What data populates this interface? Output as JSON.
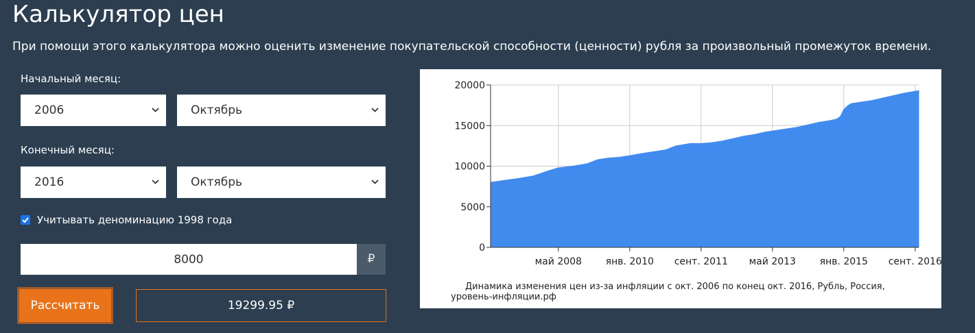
{
  "page": {
    "title": "Калькулятор цен",
    "description": "При помощи этого калькулятора можно оценить изменение покупательской способности (ценности) рубля за произвольный промежуток времени."
  },
  "form": {
    "start_label": "Начальный месяц:",
    "start_year": "2006",
    "start_month": "Октябрь",
    "end_label": "Конечный месяц:",
    "end_year": "2016",
    "end_month": "Октябрь",
    "denomination_label": "Учитывать деноминацию 1998 года",
    "denomination_checked": true,
    "amount_value": "8000",
    "currency_symbol": "₽",
    "calculate_label": "Рассчитать",
    "result": "19299.95 ₽"
  },
  "icons": {
    "select_arrow": "chevron-down-icon",
    "checkbox_mark": "check-icon"
  },
  "colors": {
    "background": "#2c3e50",
    "accent": "#e8731a",
    "series": "#418bef"
  },
  "chart_data": {
    "type": "area",
    "title": "",
    "xlabel": "",
    "ylabel": "",
    "caption_line1": "Динамика изменения цен из-за инфляции с окт. 2006 по конец окт. 2016, Рубль, Россия,",
    "caption_line2": "уровень-инфляции.рф",
    "ylim": [
      0,
      20000
    ],
    "yticks": [
      "0",
      "5000",
      "10000",
      "15000",
      "20000"
    ],
    "xticks": [
      "май 2008",
      "янв. 2010",
      "сент. 2011",
      "май 2013",
      "янв. 2015",
      "сент. 2016"
    ],
    "grid": true,
    "x": [
      "2006-10",
      "2007-01",
      "2007-06",
      "2007-10",
      "2008-02",
      "2008-05",
      "2008-09",
      "2009-01",
      "2009-04",
      "2009-07",
      "2009-10",
      "2010-01",
      "2010-05",
      "2010-08",
      "2010-11",
      "2011-02",
      "2011-06",
      "2011-09",
      "2011-12",
      "2012-03",
      "2012-06",
      "2012-09",
      "2012-12",
      "2013-03",
      "2013-06",
      "2013-09",
      "2013-12",
      "2014-03",
      "2014-06",
      "2014-09",
      "2014-11",
      "2014-12",
      "2015-01",
      "2015-02",
      "2015-03",
      "2015-06",
      "2015-09",
      "2015-12",
      "2016-03",
      "2016-06",
      "2016-10"
    ],
    "values": [
      8000,
      8200,
      8500,
      8800,
      9400,
      9800,
      10000,
      10300,
      10800,
      11000,
      11100,
      11300,
      11600,
      11800,
      12000,
      12500,
      12800,
      12800,
      12900,
      13100,
      13400,
      13700,
      13900,
      14200,
      14400,
      14600,
      14800,
      15100,
      15400,
      15600,
      15800,
      16100,
      17000,
      17400,
      17700,
      17900,
      18100,
      18400,
      18700,
      19000,
      19300
    ]
  }
}
